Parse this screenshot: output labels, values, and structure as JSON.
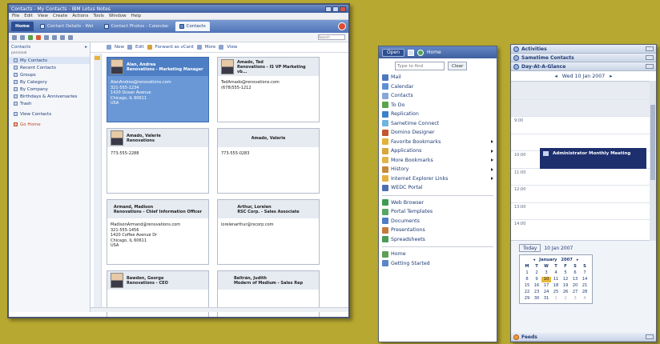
{
  "main_window": {
    "title": "Contacts - My Contacts - IBM Lotus Notes",
    "menu": [
      "File",
      "Edit",
      "View",
      "Create",
      "Actions",
      "Tools",
      "Window",
      "Help"
    ],
    "tabs": [
      {
        "label": "Home",
        "style": "home"
      },
      {
        "label": "Contact Details - Wel",
        "style": ""
      },
      {
        "label": "Contact Photos - Calendar",
        "style": ""
      },
      {
        "label": "Contacts",
        "style": "active"
      }
    ],
    "search_placeholder": "Search"
  },
  "nav": {
    "header": "Contacts",
    "sub": "personal",
    "items": [
      "My Contacts",
      "Recent Contacts",
      "Groups",
      "By Category",
      "By Company",
      "Birthdays & Anniversaries",
      "Trash"
    ],
    "group_items": [
      "View Contacts"
    ],
    "red_items": [
      "Go Home"
    ]
  },
  "content_toolbar": {
    "new": "New",
    "edit": "Edit",
    "forward": "Forward as vCard",
    "more": "More",
    "view": "View"
  },
  "cards": [
    {
      "name": "Alan, Andrea",
      "role": "Renovations - Marketing Manager",
      "lines": [
        "AlanAndrea@renovations.com",
        "321-555-1234",
        "1420 Ocean Avenue",
        "Chicago, IL 60611",
        "USA"
      ],
      "photo": true,
      "selected": true
    },
    {
      "name": "Amado, Ted",
      "role": "Renovations - IS VP Marketing vb...",
      "lines": [
        "TedAmado@renovations.com",
        "(678)555-1212"
      ],
      "photo": true,
      "selected": false
    },
    {
      "name": "Amado, Valerie",
      "role": "Renovations",
      "lines": [
        "773-555-2288"
      ],
      "photo": true,
      "selected": false
    },
    {
      "name": "Amado, Valerie",
      "role": "",
      "lines": [
        "773-555-0283"
      ],
      "photo": false,
      "selected": false
    },
    {
      "name": "Armand, Madison",
      "role": "Renovations - Chief Information Officer",
      "lines": [
        "MadisonArmand@renovations.com",
        "321-555-1456",
        "1420 Coffee Avenue Dr",
        "Chicago, IL 60611",
        "USA"
      ],
      "photo": false,
      "selected": false
    },
    {
      "name": "Arthur, Lorelen",
      "role": "RSC Corp. - Sales Associate",
      "lines": [
        "lorelenarthur@rscorp.com"
      ],
      "photo": false,
      "selected": false
    },
    {
      "name": "Bawden, George",
      "role": "Renovations - CEO",
      "lines": [],
      "photo": true,
      "selected": false
    },
    {
      "name": "Beltrán, Judith",
      "role": "Modern of Medium - Sales Rep",
      "lines": [],
      "photo": false,
      "selected": false
    }
  ],
  "start_menu": {
    "header_left": "Open",
    "header_right": "Home",
    "search_placeholder": "Type to find",
    "clear": "Clear",
    "items": [
      {
        "label": "Mail",
        "color": "#4b78c0",
        "arrow": false
      },
      {
        "label": "Calendar",
        "color": "#5d8fd6",
        "arrow": false
      },
      {
        "label": "Contacts",
        "color": "#8aa6d8",
        "arrow": false
      },
      {
        "label": "To Do",
        "color": "#5aa44c",
        "arrow": false
      },
      {
        "label": "Replication",
        "color": "#3a82c9",
        "arrow": false
      },
      {
        "label": "Sametime Connect",
        "color": "#6fb3e0",
        "arrow": false
      },
      {
        "label": "Domino Designer",
        "color": "#c2562e",
        "arrow": false
      },
      {
        "label": "Favorite Bookmarks",
        "color": "#e1b33a",
        "arrow": true
      },
      {
        "label": "Applications",
        "color": "#d9a63a",
        "arrow": true
      },
      {
        "label": "More Bookmarks",
        "color": "#e0b64a",
        "arrow": true
      },
      {
        "label": "History",
        "color": "#c58a3a",
        "arrow": true
      },
      {
        "label": "Internet Explorer Links",
        "color": "#e4b042",
        "arrow": true
      },
      {
        "label": "WEDC Portal",
        "color": "#4a6fb0",
        "arrow": false
      }
    ],
    "items2": [
      {
        "label": "Web Browser",
        "color": "#3f9b52"
      },
      {
        "label": "Portal Templates",
        "color": "#5aa565"
      },
      {
        "label": "Documents",
        "color": "#4f7cc6"
      },
      {
        "label": "Presentations",
        "color": "#c77a3a"
      },
      {
        "label": "Spreadsheets",
        "color": "#4a9c58"
      }
    ],
    "items3": [
      {
        "label": "Home",
        "color": "#5c9f55"
      },
      {
        "label": "Getting Started",
        "color": "#5b87c7"
      }
    ]
  },
  "sidebar": {
    "activities": "Activities",
    "sametime": "Sametime Contacts",
    "day": "Day-At-A-Glance",
    "date": "Wed 10 Jan 2007",
    "hours": [
      "9:00",
      "10:00",
      "11:00",
      "12:00",
      "13:00",
      "14:00"
    ],
    "appointment": "Administrator Monthly Meeting",
    "today_label": "Today",
    "today_date": "10 Jan 2007",
    "month": "January",
    "year": "2007",
    "day_names": [
      "M",
      "T",
      "W",
      "T",
      "F",
      "S",
      "S"
    ],
    "weeks": [
      [
        "1",
        "2",
        "3",
        "4",
        "5",
        "6",
        "7"
      ],
      [
        "8",
        "9",
        "10",
        "11",
        "12",
        "13",
        "14"
      ],
      [
        "15",
        "16",
        "17",
        "18",
        "19",
        "20",
        "21"
      ],
      [
        "22",
        "23",
        "24",
        "25",
        "26",
        "27",
        "28"
      ],
      [
        "29",
        "30",
        "31",
        "1",
        "2",
        "3",
        "4"
      ]
    ],
    "highlight_day": "10",
    "feeds": "Feeds"
  }
}
